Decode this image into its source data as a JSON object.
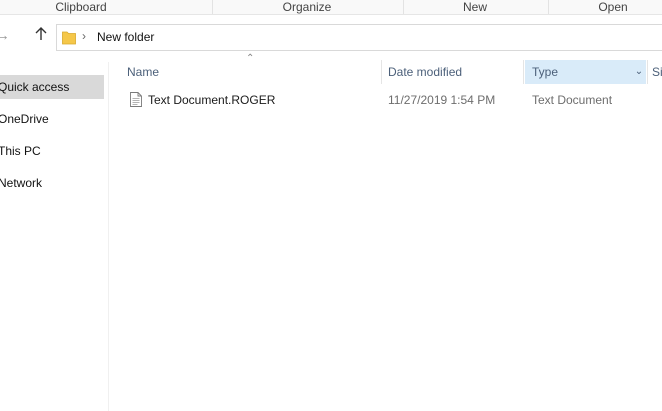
{
  "ribbon": {
    "groups": [
      "Clipboard",
      "Organize",
      "New",
      "Open"
    ]
  },
  "address_bar": {
    "path": [
      "New folder"
    ]
  },
  "nav_pane": {
    "items": [
      {
        "label": "Quick access",
        "selected": true
      },
      {
        "label": "OneDrive"
      },
      {
        "label": "This PC"
      },
      {
        "label": "Network"
      }
    ]
  },
  "columns": {
    "name": "Name",
    "date_modified": "Date modified",
    "type": "Type",
    "size": "Size"
  },
  "files": [
    {
      "name": "Text Document.ROGER",
      "date_modified": "11/27/2019 1:54 PM",
      "type": "Text Document"
    }
  ],
  "colors": {
    "selected_nav": "#d9d9d9",
    "header_hover": "#d9ebf9",
    "header_text": "#4c607a",
    "folder": "#f5c749"
  }
}
